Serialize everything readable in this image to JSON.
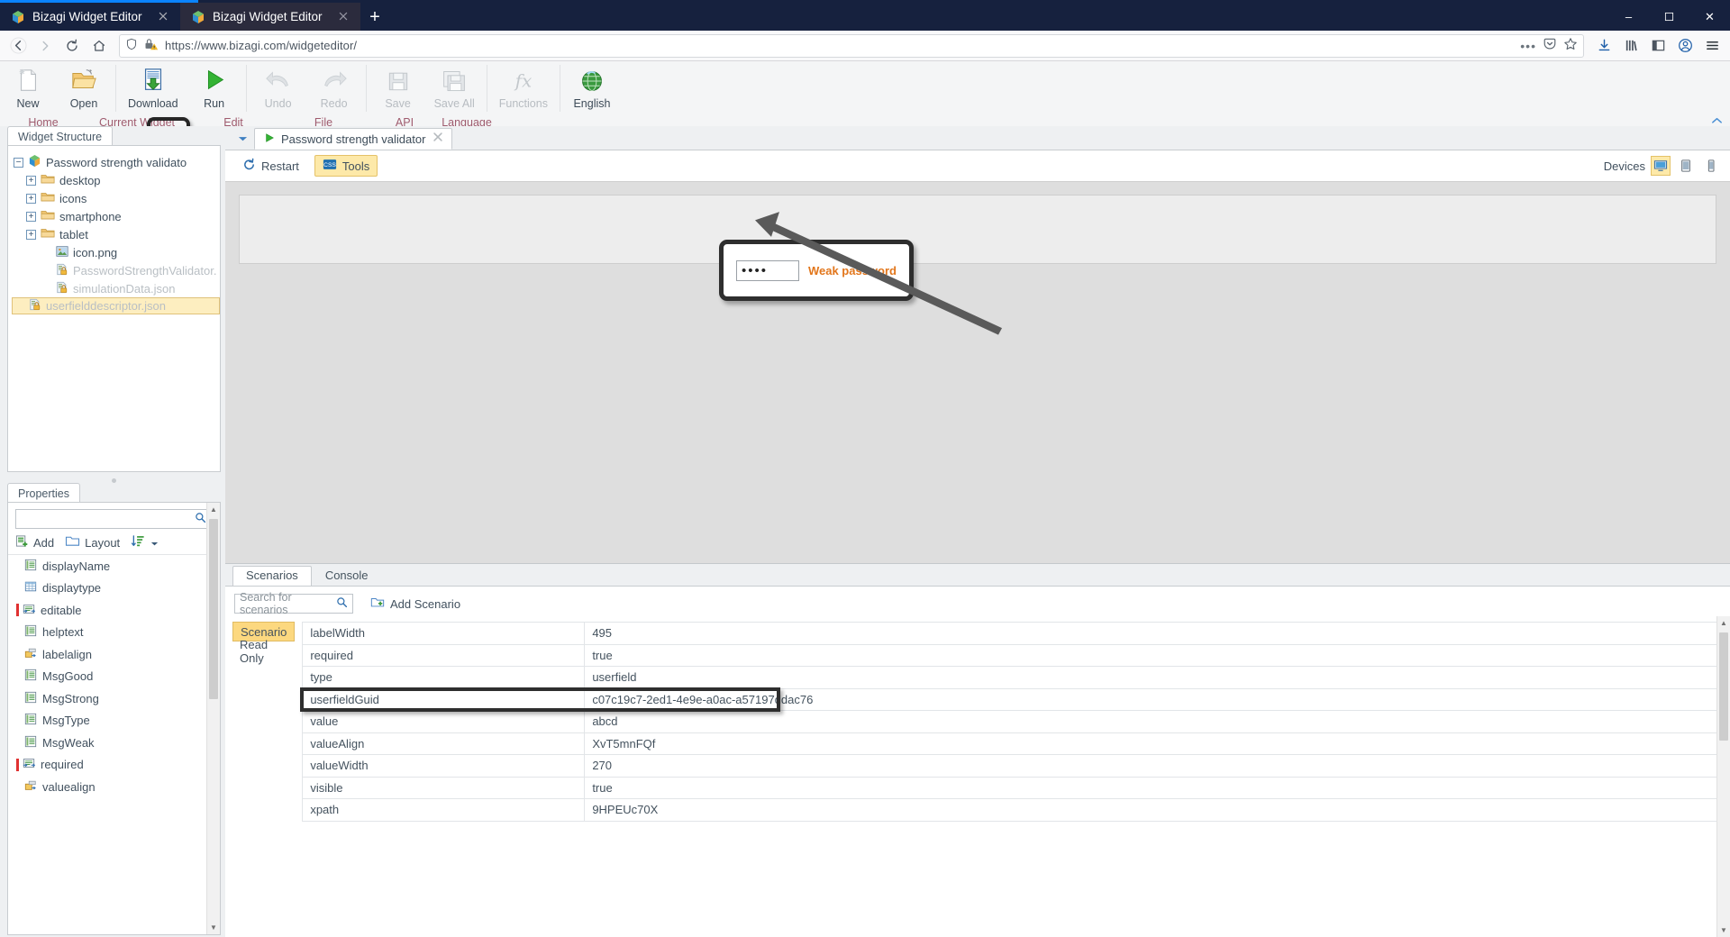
{
  "browser": {
    "tabs": [
      {
        "title": "Bizagi Widget Editor",
        "favicon": "bizagi-cube-icon",
        "active": false
      },
      {
        "title": "Bizagi Widget Editor",
        "favicon": "bizagi-cube-icon",
        "active": true
      }
    ],
    "new_tab_label": "+",
    "window_buttons": {
      "minimize": "–",
      "maximize": "❐",
      "close": "✕"
    },
    "nav": {
      "back": "←",
      "forward": "→",
      "reload": "↻",
      "home": "⌂"
    },
    "url": "https://www.bizagi.com/widgeteditor/",
    "url_shield": "shield-icon",
    "url_lock_warning": "lock-warning-icon",
    "page_actions": "•••",
    "pocket": "pocket-icon",
    "bookmark": "star-icon",
    "downloads": "download-icon",
    "library": "library-icon",
    "sidebar": "sidebar-icon",
    "account": "account-icon",
    "menu": "hamburger-menu-icon"
  },
  "ribbon": {
    "buttons": [
      {
        "label": "New",
        "icon": "new-file-icon",
        "disabled": false
      },
      {
        "label": "Open",
        "icon": "open-folder-icon",
        "disabled": false
      },
      {
        "label": "Download",
        "icon": "download-widget-icon",
        "disabled": false
      },
      {
        "label": "Run",
        "icon": "run-play-icon",
        "disabled": false,
        "highlighted": true
      },
      {
        "label": "Undo",
        "icon": "undo-arrow-icon",
        "disabled": true
      },
      {
        "label": "Redo",
        "icon": "redo-arrow-icon",
        "disabled": true
      },
      {
        "label": "Save",
        "icon": "save-diskette-icon",
        "disabled": true
      },
      {
        "label": "Save All",
        "icon": "save-all-icon",
        "disabled": true
      },
      {
        "label": "Functions",
        "icon": "fx-functions-icon",
        "disabled": true
      },
      {
        "label": "English",
        "icon": "globe-language-icon",
        "disabled": false
      }
    ],
    "groups": [
      {
        "label": "Home",
        "center": 48
      },
      {
        "label": "Current Widget",
        "center": 152
      },
      {
        "label": "Edit",
        "center": 259
      },
      {
        "label": "File",
        "center": 359
      },
      {
        "label": "API",
        "center": 449
      },
      {
        "label": "Language",
        "center": 518
      }
    ],
    "collapse_icon": "chevron-up-icon"
  },
  "left_panel": {
    "structure_tab": "Widget Structure",
    "tree": [
      {
        "label": "Password strength validato",
        "icon": "bizagi-cube-icon",
        "expander": "−",
        "indent": 0,
        "selected": false,
        "locked": false
      },
      {
        "label": "desktop",
        "icon": "folder-icon",
        "expander": "+",
        "indent": 1,
        "selected": false,
        "locked": false
      },
      {
        "label": "icons",
        "icon": "folder-icon",
        "expander": "+",
        "indent": 1,
        "selected": false,
        "locked": false
      },
      {
        "label": "smartphone",
        "icon": "folder-icon",
        "expander": "+",
        "indent": 1,
        "selected": false,
        "locked": false
      },
      {
        "label": "tablet",
        "icon": "folder-icon",
        "expander": "+",
        "indent": 1,
        "selected": false,
        "locked": false
      },
      {
        "label": "icon.png",
        "icon": "image-file-icon",
        "expander": "",
        "indent": 2,
        "selected": false,
        "locked": false
      },
      {
        "label": "PasswordStrengthValidator.",
        "icon": "locked-file-icon",
        "expander": "",
        "indent": 2,
        "selected": false,
        "locked": true
      },
      {
        "label": "simulationData.json",
        "icon": "locked-file-icon",
        "expander": "",
        "indent": 2,
        "selected": false,
        "locked": true
      },
      {
        "label": "userfielddescriptor.json",
        "icon": "locked-file-icon",
        "expander": "",
        "indent": 2,
        "selected": true,
        "locked": true
      }
    ],
    "properties_tab": "Properties",
    "search_placeholder": "",
    "search_value": "",
    "search_icon": "search-icon",
    "tools": [
      {
        "label": "Add",
        "icon": "add-property-icon"
      },
      {
        "label": "Layout",
        "icon": "layout-folder-icon"
      },
      {
        "label": "",
        "icon": "sort-icon"
      }
    ],
    "properties": [
      {
        "label": "displayName",
        "icon": "text-property-icon",
        "required": false
      },
      {
        "label": "displaytype",
        "icon": "table-property-icon",
        "required": false
      },
      {
        "label": "editable",
        "icon": "bool-property-icon",
        "required": true
      },
      {
        "label": "helptext",
        "icon": "text-property-icon",
        "required": false
      },
      {
        "label": "labelalign",
        "icon": "align-property-icon",
        "required": false
      },
      {
        "label": "MsgGood",
        "icon": "text-property-icon",
        "required": false
      },
      {
        "label": "MsgStrong",
        "icon": "text-property-icon",
        "required": false
      },
      {
        "label": "MsgType",
        "icon": "text-property-icon",
        "required": false
      },
      {
        "label": "MsgWeak",
        "icon": "text-property-icon",
        "required": false
      },
      {
        "label": "required",
        "icon": "bool-property-icon",
        "required": true
      },
      {
        "label": "valuealign",
        "icon": "align-property-icon",
        "required": false
      }
    ]
  },
  "editor": {
    "doc_tab": {
      "label": "Password strength validator",
      "icon": "run-play-icon",
      "close": "✕"
    },
    "dropdown_caret": "chevron-down-icon",
    "preview_toolbar": {
      "restart": {
        "label": "Restart",
        "icon": "restart-icon"
      },
      "tools": {
        "label": "Tools",
        "icon": "tools-icon",
        "active": true
      },
      "devices_label": "Devices",
      "devices": [
        {
          "name": "desktop-device-icon",
          "active": true
        },
        {
          "name": "tablet-device-icon",
          "active": false
        },
        {
          "name": "smartphone-device-icon",
          "active": false
        }
      ]
    },
    "widget_preview": {
      "password_value": "••••",
      "strength_message": "Weak password",
      "strength_color": "#e2761b"
    }
  },
  "bottom_panel": {
    "tabs": [
      {
        "label": "Scenarios",
        "active": true
      },
      {
        "label": "Console",
        "active": false
      }
    ],
    "search_placeholder": "Search for scenarios",
    "search_icon": "search-icon",
    "add_scenario": {
      "label": "Add Scenario",
      "icon": "add-scenario-icon"
    },
    "scenarios": [
      {
        "label": "Scenario",
        "selected": true
      },
      {
        "label": "Read Only",
        "selected": false
      }
    ],
    "properties": [
      {
        "key": "labelWidth",
        "value": "495"
      },
      {
        "key": "required",
        "value": "true"
      },
      {
        "key": "type",
        "value": "userfield"
      },
      {
        "key": "userfieldGuid",
        "value": "c07c19c7-2ed1-4e9e-a0ac-a57197ddac76"
      },
      {
        "key": "value",
        "value": "abcd",
        "highlighted": true
      },
      {
        "key": "valueAlign",
        "value": "XvT5mnFQf"
      },
      {
        "key": "valueWidth",
        "value": "270"
      },
      {
        "key": "visible",
        "value": "true"
      },
      {
        "key": "xpath",
        "value": "9HPEUc70X"
      }
    ]
  },
  "colors": {
    "accent": "#fcd87f",
    "group_label": "#9f5b6e",
    "warning": "#e2761b",
    "tab_active": "#2b2b3d"
  }
}
